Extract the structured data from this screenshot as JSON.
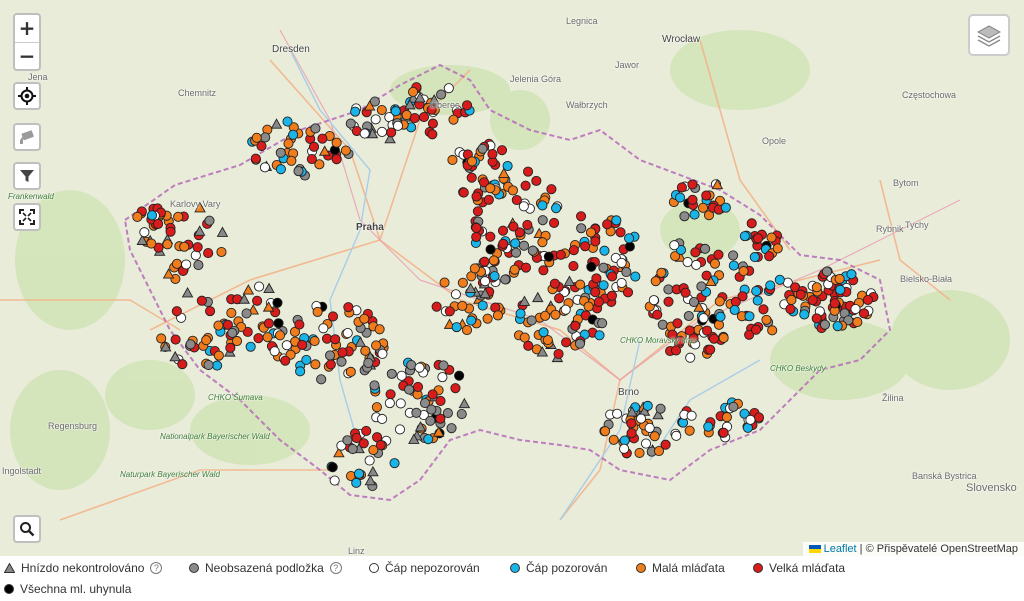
{
  "map": {
    "labels": {
      "dresden": "Dresden",
      "wroclaw": "Wrocław",
      "praha": "Praha",
      "brno": "Brno",
      "chemnitz": "Chemnitz",
      "legnica": "Legnica",
      "walbrzych": "Wałbrzych",
      "opole": "Opole",
      "czestochowa": "Częstochowa",
      "bytom": "Bytom",
      "rybnik": "Rybnik",
      "bielsko": "Bielsko-Biała",
      "regensburg": "Regensburg",
      "ingolstadt": "Ingolstadt",
      "linz": "Linz",
      "zilina": "Žilina",
      "bystrica": "Banská Bystrica",
      "slovensko": "Slovensko",
      "karlovy": "Karlovy Vary",
      "jelenia": "Jelenia Góra",
      "liberec": "Liberec",
      "jawor": "Jawor",
      "tychy": "Tychy",
      "jena": "Jena",
      "beskydy": "CHKO Beskydy",
      "sumava": "CHKO Šumava",
      "kras": "CHKO Moravský kras",
      "bayerwald": "Naturpark Bayerischer Wald",
      "frankenwald": "Frankenwald",
      "bavor": "Nationalpark Bayerischer Wald"
    },
    "markers": {
      "colors": {
        "uncontrolled": "#888888",
        "empty": "#8a8a8a",
        "not_observed": "#ffffff",
        "observed": "#19b4e8",
        "small": "#f07c1c",
        "large": "#d81b1b",
        "died": "#000000"
      }
    }
  },
  "controls": {
    "zoom_in": "+",
    "zoom_out": "−",
    "locate_icon": "crosshair-icon",
    "camera_icon": "camera-icon",
    "filter_icon": "filter-icon",
    "fullscreen_icon": "fullscreen-icon",
    "search_icon": "search-icon",
    "layers_icon": "layers-icon"
  },
  "attribution": {
    "leaflet": "Leaflet",
    "separator": " | © ",
    "osm": "Přispěvatelé OpenStreetMap"
  },
  "legend": {
    "uncontrolled": "Hnízdo nekontrolováno",
    "empty": "Neobsazená podložka",
    "not_observed": "Čáp nepozorován",
    "observed": "Čáp pozorován",
    "small": "Malá mláďata",
    "large": "Velká mláďata",
    "died": "Všechna ml. uhynula",
    "help": "?"
  }
}
